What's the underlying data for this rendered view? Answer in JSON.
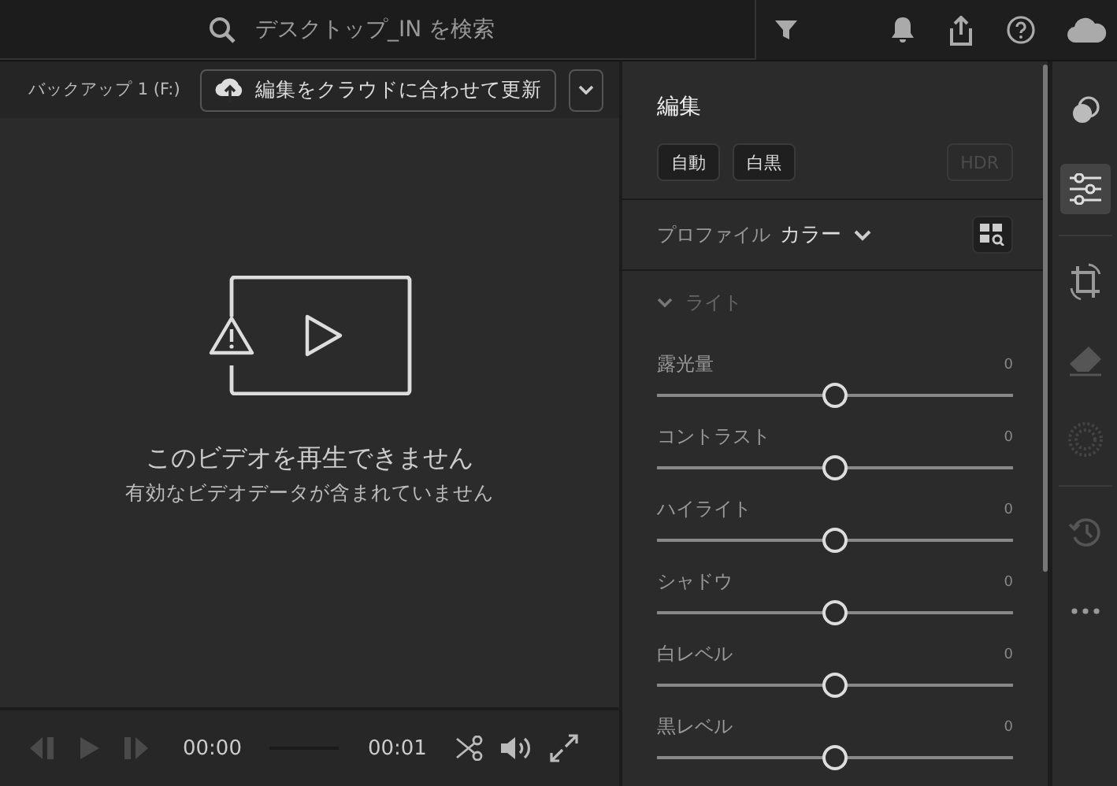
{
  "search": {
    "placeholder": "デスクトップ_IN を検索"
  },
  "video": {
    "title": "バックアップ 1 (F:)",
    "sync_button": "編集をクラウドに合わせて更新",
    "error_title": "このビデオを再生できません",
    "error_message": "有効なビデオデータが含まれていません",
    "current_time": "00:00",
    "duration": "00:01",
    "transport": [
      {
        "kind": "prev",
        "disabled": true
      },
      {
        "kind": "play",
        "disabled": true
      },
      {
        "kind": "next",
        "disabled": true
      }
    ]
  },
  "edit_panel": {
    "title": "編集",
    "buttons": [
      {
        "label": "自動",
        "disabled": false
      },
      {
        "label": "白黒",
        "disabled": false
      },
      {
        "label": "HDR",
        "disabled": true
      }
    ],
    "profile_label": "プロファイル",
    "profile_value": "カラー",
    "section": {
      "title": "ライト",
      "expanded": true
    },
    "sliders": [
      {
        "label": "露光量",
        "value": "0",
        "level": 0.5
      },
      {
        "label": "コントラスト",
        "value": "0",
        "level": 0.5
      },
      {
        "label": "ハイライト",
        "value": "0",
        "level": 0.5
      },
      {
        "label": "シャドウ",
        "value": "0",
        "level": 0.5
      },
      {
        "label": "白レベル",
        "value": "0",
        "level": 0.5
      },
      {
        "label": "黒レベル",
        "value": "0",
        "level": 0.5
      }
    ]
  },
  "tool_rail": [
    {
      "kind": "presets",
      "selected": false
    },
    {
      "kind": "edit",
      "selected": true
    },
    {
      "kind": "crop",
      "selected": false
    },
    {
      "kind": "heal",
      "selected": false
    },
    {
      "kind": "mask",
      "selected": false
    },
    {
      "kind": "history",
      "selected": false
    },
    {
      "kind": "more",
      "selected": false
    }
  ]
}
